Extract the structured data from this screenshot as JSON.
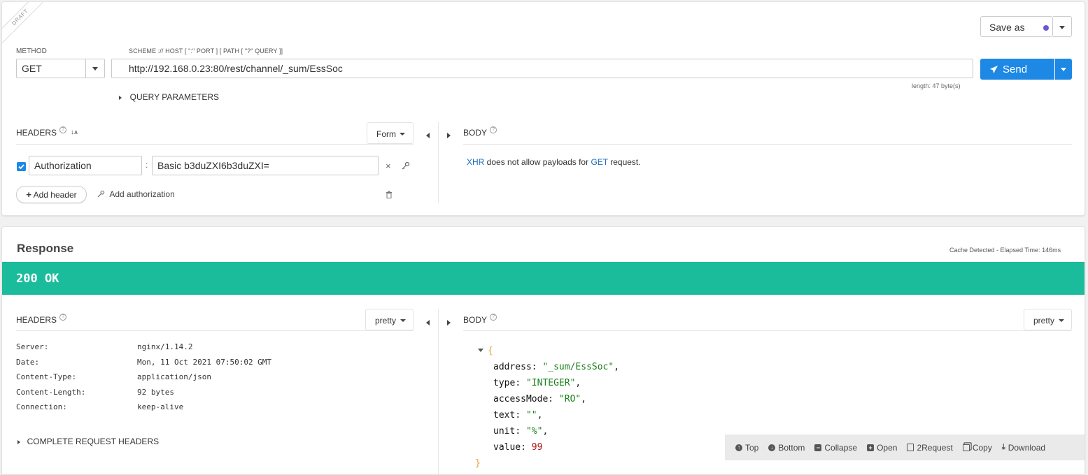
{
  "request": {
    "draft_ribbon": "DRAFT",
    "method_label": "METHOD",
    "method_value": "GET",
    "url_label": "SCHEME :// HOST [ \":\" PORT ] [ PATH [ \"?\" QUERY ]]",
    "url_value": "http://192.168.0.23:80/rest/channel/_sum/EssSoc",
    "url_length": "length: 47 byte(s)",
    "save_as": "Save as",
    "send": "Send",
    "query_params": "QUERY PARAMETERS",
    "headers_title": "HEADERS",
    "headers_mode": "Form",
    "header_row": {
      "checked": true,
      "name": "Authorization",
      "value": "Basic b3duZXI6b3duZXI="
    },
    "add_header": "Add header",
    "add_authorization": "Add authorization",
    "body_title": "BODY",
    "body_note": {
      "xhr": "XHR",
      "middle": " does not allow payloads for ",
      "get": "GET",
      "end": " request."
    }
  },
  "response": {
    "title": "Response",
    "meta": "Cache Detected - Elapsed Time: 146ms",
    "status": "200 OK",
    "status_color": "#1abc9c",
    "headers_title": "HEADERS",
    "headers_mode": "pretty",
    "headers": [
      {
        "name": "Server:",
        "value": "nginx/1.14.2"
      },
      {
        "name": "Date:",
        "value": "Mon, 11 Oct 2021 07:50:02 GMT"
      },
      {
        "name": "Content-Type:",
        "value": "application/json"
      },
      {
        "name": "Content-Length:",
        "value": "92 bytes"
      },
      {
        "name": "Connection:",
        "value": "keep-alive"
      }
    ],
    "complete_request_headers": "COMPLETE REQUEST HEADERS",
    "body_title": "BODY",
    "body_mode": "pretty",
    "json": [
      {
        "key": "address",
        "value": "\"_sum/EssSoc\"",
        "type": "str"
      },
      {
        "key": "type",
        "value": "\"INTEGER\"",
        "type": "str"
      },
      {
        "key": "accessMode",
        "value": "\"RO\"",
        "type": "str"
      },
      {
        "key": "text",
        "value": "\"\"",
        "type": "str"
      },
      {
        "key": "unit",
        "value": "\"%\"",
        "type": "str"
      },
      {
        "key": "value",
        "value": "99",
        "type": "num"
      }
    ],
    "toolbar": {
      "top": "Top",
      "bottom": "Bottom",
      "collapse": "Collapse",
      "open": "Open",
      "to_request": "2Request",
      "copy": "Copy",
      "download": "Download"
    }
  },
  "colors": {
    "accent": "#1e88e5",
    "status_bar": "#1abc9c",
    "save_dot": "#6a5acd"
  }
}
